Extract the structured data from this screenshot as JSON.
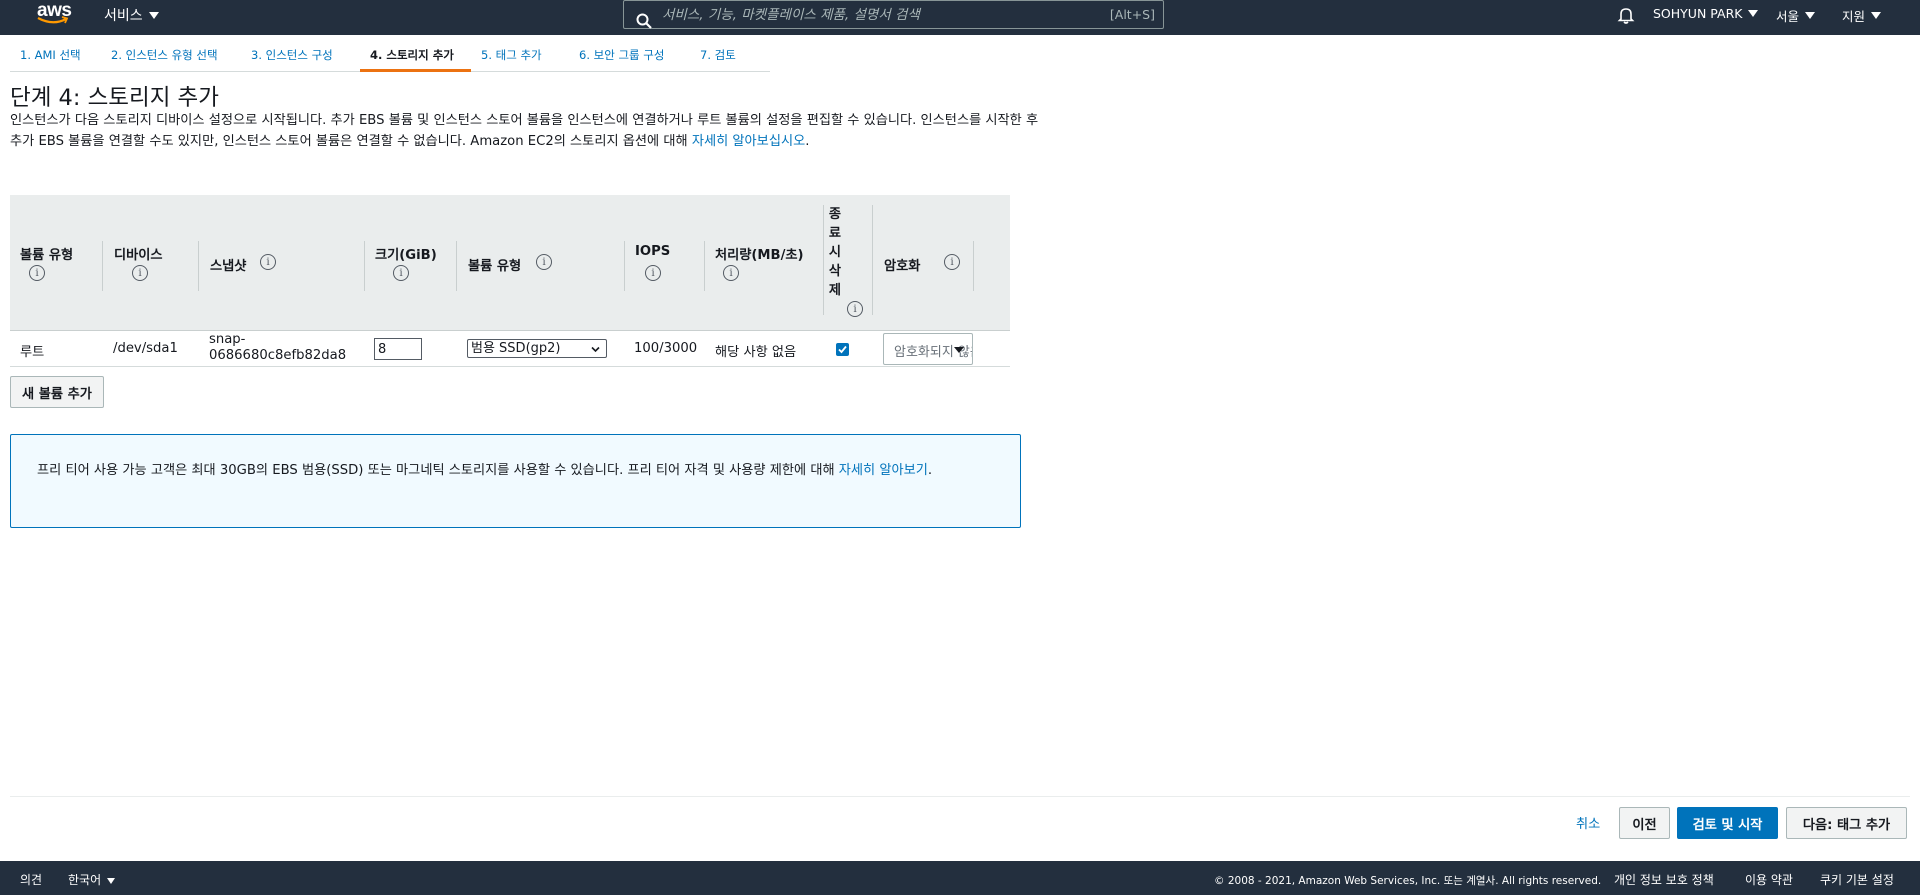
{
  "topnav": {
    "logo_text": "aws",
    "services_label": "서비스",
    "search_placeholder": "서비스, 기능, 마켓플레이스 제품, 설명서 검색",
    "search_shortcut": "[Alt+S]",
    "user_label": "SOHYUN PARK",
    "region_label": "서울",
    "support_label": "지원",
    "colors": {
      "background": "#232f3e"
    }
  },
  "steps": [
    {
      "label": "1. AMI 선택",
      "active": false
    },
    {
      "label": "2. 인스턴스 유형 선택",
      "active": false
    },
    {
      "label": "3. 인스턴스 구성",
      "active": false
    },
    {
      "label": "4. 스토리지 추가",
      "active": true
    },
    {
      "label": "5. 태그 추가",
      "active": false
    },
    {
      "label": "6. 보안 그룹 구성",
      "active": false
    },
    {
      "label": "7. 검토",
      "active": false
    }
  ],
  "page": {
    "title": "단계 4: 스토리지 추가",
    "description_line1": "인스턴스가 다음 스토리지 디바이스 설정으로 시작됩니다. 추가 EBS 볼륨 및 인스턴스 스토어 볼륨을 인스턴스에 연결하거나 루트 볼륨의 설정을 편집할 수 있습니",
    "description_line2": "다. 인스턴스를 시작한 후 추가 EBS 볼륨을 연결할 수도 있지만, 인스턴스 스토어 볼륨은 연결할 수 없습니다. Amazon EC2의 스토리지 옵션에 대해 ",
    "description_link": "자세히 알아보십시오",
    "description_end": "."
  },
  "table": {
    "headers": {
      "volume_type": "볼륨 유형",
      "device": "디바이스",
      "snapshot": "스냅샷",
      "size": "크기(GiB)",
      "ebs_volume_type": "볼륨 유형",
      "iops": "IOPS",
      "throughput": "처리량(MB/초)",
      "delete_on_termination": [
        "종",
        "료",
        "시",
        "삭",
        "제"
      ],
      "encryption": "암호화",
      "info_glyph": "i"
    },
    "rows": [
      {
        "volume_type": "루트",
        "device": "/dev/sda1",
        "snapshot_line1": "snap-",
        "snapshot_line2": "0686680c8efb82da8",
        "size": "8",
        "ebs_volume_type": "범용 SSD(gp2)",
        "iops": "100/3000",
        "throughput": "해당 사항 없음",
        "delete_on_termination": true,
        "encryption": "암호화되지 않음"
      }
    ]
  },
  "add_volume_label": "새 볼륨 추가",
  "notice": {
    "text": "프리 티어 사용 가능 고객은 최대 30GB의 EBS 범용(SSD) 또는 마그네틱 스토리지를 사용할 수 있습니다. 프리 티어 자격 및 사용량 제한에 대해 ",
    "link": "자세히 알아보기",
    "end": "."
  },
  "actions": {
    "cancel": "취소",
    "previous": "이전",
    "review_launch": "검토 및 시작",
    "next": "다음: 태그 추가"
  },
  "footer": {
    "feedback": "의견",
    "language": "한국어",
    "copyright": "© 2008 - 2021, Amazon Web Services, Inc. 또는 계열사. All rights reserved.",
    "privacy": "개인 정보 보호 정책",
    "terms": "이용 약관",
    "cookies": "쿠키 기본 설정"
  },
  "colors": {
    "accent": "#0073bb",
    "active_step": "#ec7211",
    "table_header_bg": "#eaeded",
    "notice_bg": "#f1faff"
  }
}
